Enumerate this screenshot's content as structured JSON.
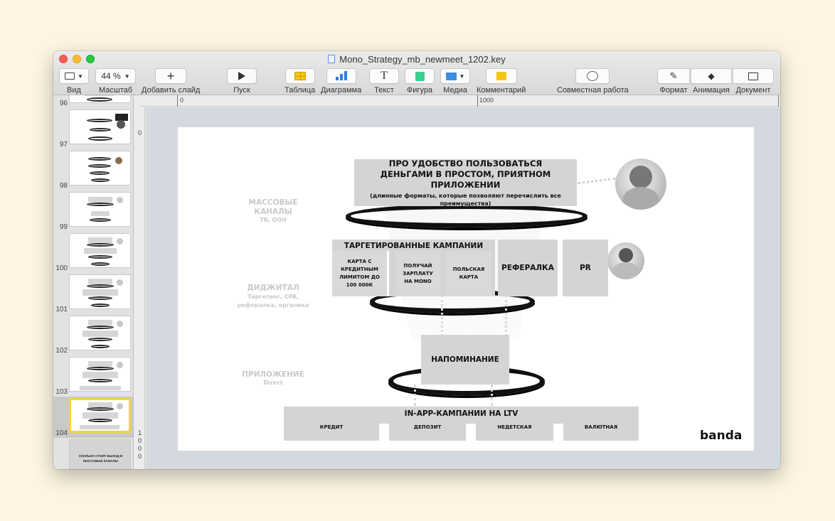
{
  "window": {
    "title": "Mono_Strategy_mb_newmeet_1202.key"
  },
  "toolbar": {
    "view": "Вид",
    "zoom_value": "44 %",
    "zoom": "Масштаб",
    "add_slide": "Добавить слайд",
    "play": "Пуск",
    "table": "Таблица",
    "chart": "Диаграмма",
    "text": "Текст",
    "shape": "Фигура",
    "media": "Медиа",
    "comment": "Комментарий",
    "collaborate": "Совместная работа",
    "format": "Формат",
    "animate": "Анимация",
    "document": "Документ"
  },
  "ruler": {
    "h0": "0",
    "h1000": "1000",
    "v0": "0",
    "v1000": [
      "1",
      "0",
      "0",
      "0"
    ]
  },
  "sidebar": {
    "slides": [
      "96",
      "97",
      "98",
      "99",
      "100",
      "101",
      "102",
      "103",
      "104"
    ],
    "selected": "104",
    "last_thumb_text": "СКОЛЬКО СТОИТ ВЫХОД В МАССОВЫЕ КАНАЛЫ"
  },
  "slide": {
    "top_title": "ПРО УДОБСТВО ПОЛЬЗОВАТЬСЯ ДЕНЬГАМИ В ПРОСТОМ, ПРИЯТНОМ ПРИЛОЖЕНИИ",
    "top_sub": "(длинные форматы, которые позволяют перечислить все преимущества)",
    "mass_title": "МАССОВЫЕ КАНАЛЫ",
    "mass_sub": "ТВ, ООН",
    "targeted_title": "ТАРГЕТИРОВАННЫЕ КАМПАНИИ",
    "card_credit": "КАРТА С КРЕДИТНЫМ ЛИМИТОМ ДО 100 000К",
    "card_salary": "ПОЛУЧАЙ ЗАРПЛАТУ НА MONO",
    "card_polish": "ПОЛЬСКАЯ КАРТА",
    "referral": "РЕФЕРАЛКА",
    "pr": "PR",
    "digital_title": "ДИДЖИТАЛ",
    "digital_sub": "Таргетинг, CPA, рефералка, органика",
    "reminder": "НАПОМИНАНИЕ",
    "app_title": "ПРИЛОЖЕНИЕ",
    "app_sub": "Direct",
    "inapp_title": "IN-APP-КАМПАНИИ НА LTV",
    "inapp_items": [
      "КРЕДИТ",
      "ДЕПОЗИТ",
      "НЕДЕТСКАЯ",
      "ВАЛЮТНАЯ"
    ],
    "logo": "banda"
  }
}
